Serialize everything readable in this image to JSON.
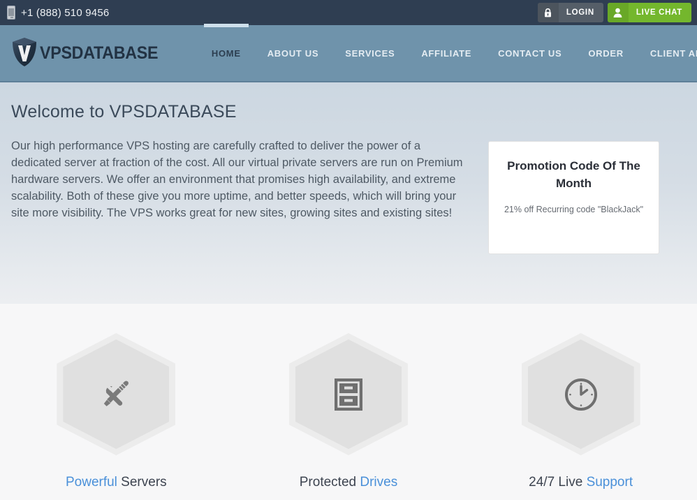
{
  "topbar": {
    "phone_icon": "mobile-phone-icon",
    "phone": "+1 (888) 510 9456",
    "login_label": "LOGIN",
    "login_icon": "lock-icon",
    "chat_label": "LIVE CHAT",
    "chat_icon": "user-icon",
    "background": "#2f3e52",
    "login_color": "#555e68",
    "chat_color": "#74b72d"
  },
  "nav": {
    "logo_text": "VPSDATABASE",
    "logo_icon": "shield-v-logo-icon",
    "background": "#6f93ab",
    "active_color": "#2c3e50",
    "items": [
      {
        "label": "HOME",
        "active": true
      },
      {
        "label": "ABOUT US",
        "active": false
      },
      {
        "label": "SERVICES",
        "active": false
      },
      {
        "label": "AFFILIATE",
        "active": false
      },
      {
        "label": "CONTACT US",
        "active": false
      },
      {
        "label": "ORDER",
        "active": false
      },
      {
        "label": "CLIENT AREA",
        "active": false
      }
    ]
  },
  "welcome": {
    "title": "Welcome to VPSDATABASE",
    "paragraph": "Our high performance VPS hosting are carefully crafted to deliver the power of a dedicated server at fraction of the cost. All our virtual private servers are run on Premium hardware servers. We offer an environment that promises high availability, and extreme scalability. Both of these give you more uptime, and better speeds, which will bring your site more visibility. The VPS works great for new sites, growing sites and existing sites!"
  },
  "promo": {
    "title": "Promotion Code Of The Month",
    "subtitle": "21% off Recurring code \"BlackJack\""
  },
  "features": {
    "accent_color": "#4a90d9",
    "items": [
      {
        "icon": "tools-wrench-screwdriver-icon",
        "highlight": "Powerful",
        "rest": " Servers",
        "highlight_first": true
      },
      {
        "icon": "filing-cabinet-drives-icon",
        "highlight": "Drives",
        "rest": "Protected ",
        "highlight_first": false
      },
      {
        "icon": "clock-icon",
        "highlight": "Support",
        "rest": "24/7 Live ",
        "highlight_first": false
      }
    ]
  }
}
